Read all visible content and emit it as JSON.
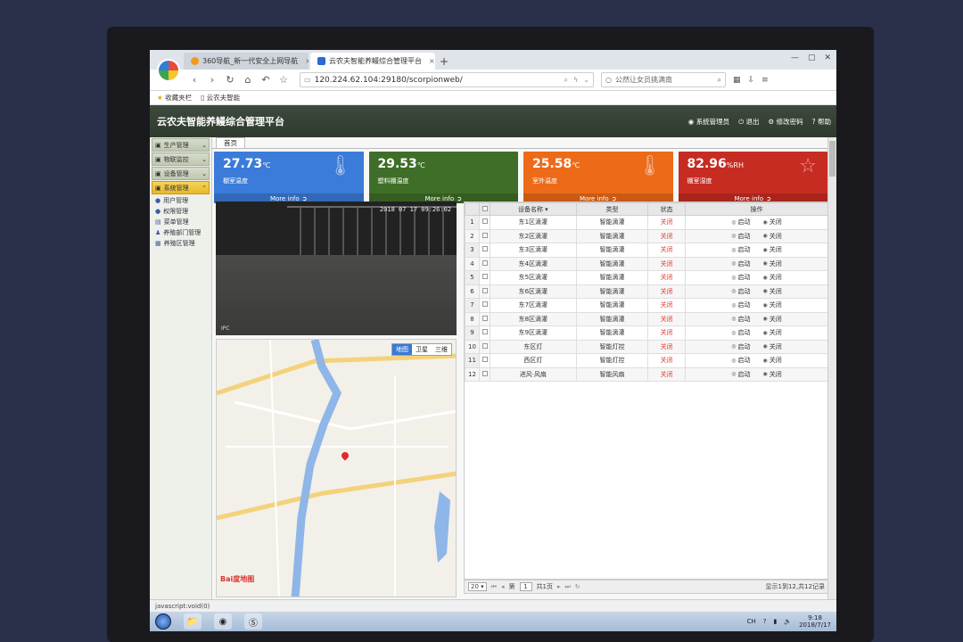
{
  "browser": {
    "tabs": [
      {
        "title": "360导航_新一代安全上网导航",
        "active": false
      },
      {
        "title": "云农夫智能养鳗综合管理平台",
        "active": true
      }
    ],
    "new_tab": "+",
    "address": "120.224.62.104:29180/scorpionweb/",
    "search_text": "公然让女员挑满南",
    "bookmarks": [
      "收藏夹栏",
      "云农夫智能"
    ]
  },
  "app": {
    "title": "云农夫智能养鳗综合管理平台",
    "user_links": [
      "系统管理员",
      "退出",
      "修改密码",
      "帮助"
    ]
  },
  "sidebar": {
    "groups": [
      {
        "label": "生产管理",
        "active": false
      },
      {
        "label": "物联监控",
        "active": false
      },
      {
        "label": "设备管理",
        "active": false
      },
      {
        "label": "系统管理",
        "active": true
      }
    ],
    "items": [
      "用户管理",
      "权限管理",
      "菜单管理",
      "养殖部门管理",
      "养殖区管理"
    ]
  },
  "home_tab": "首页",
  "cards": [
    {
      "value": "27.73",
      "unit": "℃",
      "label": "棚室温度",
      "more": "More info",
      "color": "#3b7bd9"
    },
    {
      "value": "29.53",
      "unit": "℃",
      "label": "塑料棚温度",
      "more": "More info",
      "color": "#3f6e28"
    },
    {
      "value": "25.58",
      "unit": "℃",
      "label": "室外温度",
      "more": "More info",
      "color": "#ec6a18"
    },
    {
      "value": "82.96",
      "unit": "%RH",
      "label": "棚室湿度",
      "more": "More info",
      "color": "#c72c22"
    }
  ],
  "camera": {
    "timestamp": "2018 07 17 09:26:02",
    "label": "IPC"
  },
  "map": {
    "toggles": [
      "地图",
      "卫星",
      "三维"
    ],
    "active_toggle": "地图",
    "logo": "Bai度地图"
  },
  "grid": {
    "headers": [
      "设备名称",
      "类型",
      "状态",
      "操作"
    ],
    "rows": [
      {
        "num": "1",
        "name": "东1区滴灌",
        "type": "智能滴灌",
        "status": "关闭"
      },
      {
        "num": "2",
        "name": "东2区滴灌",
        "type": "智能滴灌",
        "status": "关闭"
      },
      {
        "num": "3",
        "name": "东3区滴灌",
        "type": "智能滴灌",
        "status": "关闭"
      },
      {
        "num": "4",
        "name": "东4区滴灌",
        "type": "智能滴灌",
        "status": "关闭"
      },
      {
        "num": "5",
        "name": "东5区滴灌",
        "type": "智能滴灌",
        "status": "关闭"
      },
      {
        "num": "6",
        "name": "东6区滴灌",
        "type": "智能滴灌",
        "status": "关闭"
      },
      {
        "num": "7",
        "name": "东7区滴灌",
        "type": "智能滴灌",
        "status": "关闭"
      },
      {
        "num": "8",
        "name": "东8区滴灌",
        "type": "智能滴灌",
        "status": "关闭"
      },
      {
        "num": "9",
        "name": "东9区滴灌",
        "type": "智能滴灌",
        "status": "关闭"
      },
      {
        "num": "10",
        "name": "东区灯",
        "type": "智能灯控",
        "status": "关闭"
      },
      {
        "num": "11",
        "name": "西区灯",
        "type": "智能灯控",
        "status": "关闭"
      },
      {
        "num": "12",
        "name": "进风·风扇",
        "type": "智能风扇",
        "status": "关闭"
      }
    ],
    "op_start": "启动",
    "op_stop": "关闭"
  },
  "pager": {
    "page_size": "20",
    "page_prefix": "第",
    "page": "1",
    "page_suffix": "共1页",
    "info": "显示1到12,共12记录"
  },
  "status_text": "javascript:void(0)",
  "tray": {
    "time": "9:18",
    "date": "2018/7/17",
    "lang": "CH"
  }
}
